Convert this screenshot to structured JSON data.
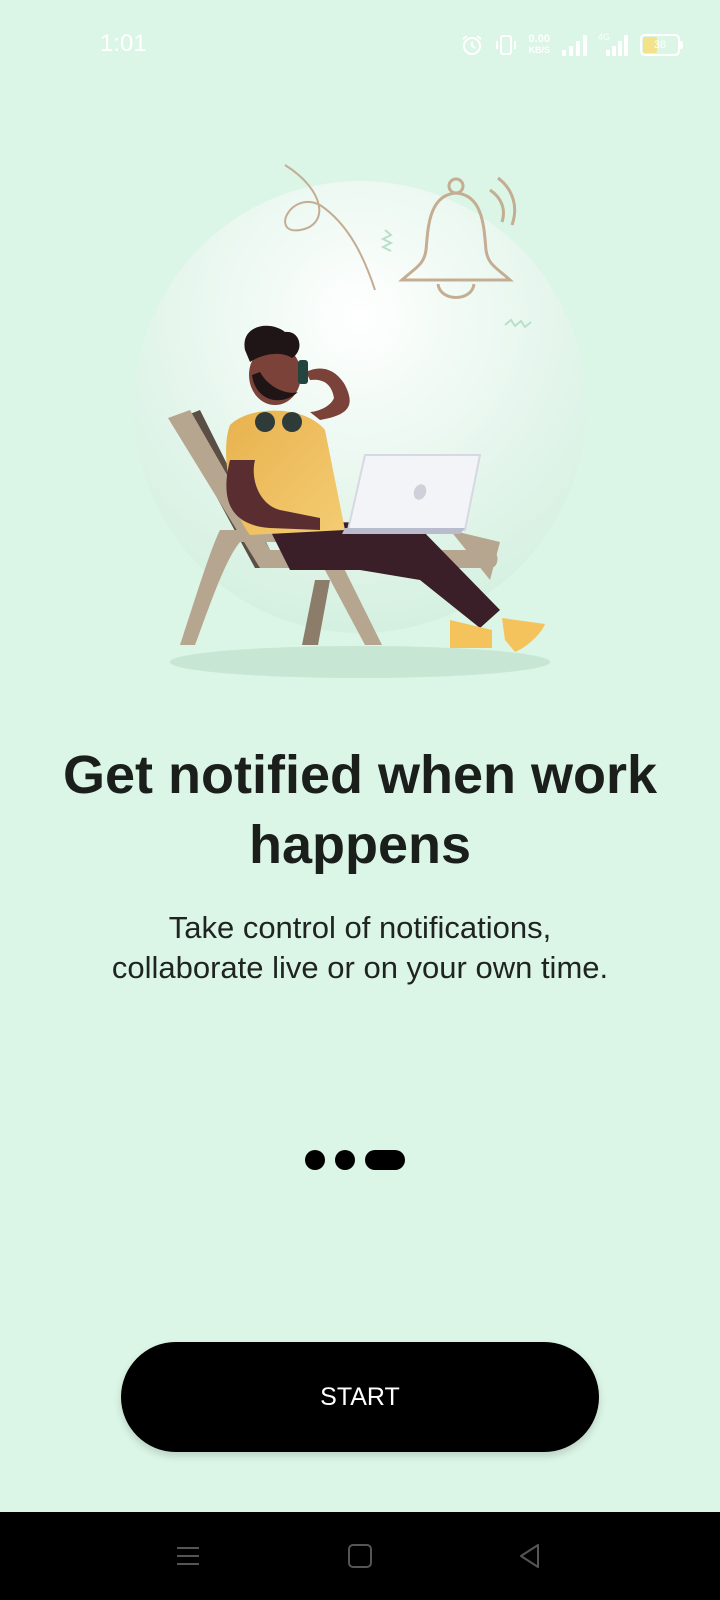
{
  "status_bar": {
    "time": "1:01",
    "net_speed_value": "0.00",
    "net_speed_unit": "KB/S",
    "network_type": "4G",
    "battery_level": "38",
    "icons": [
      "alarm-icon",
      "vibrate-icon",
      "signal-icon",
      "signal-4g-icon",
      "battery-icon"
    ]
  },
  "onboarding": {
    "illustration": "man-on-lounge-chair-with-laptop-and-bell",
    "title": "Get notified when work happens",
    "subtitle_line1": "Take control of notifications,",
    "subtitle_line2": "collaborate live or on your own time.",
    "page_indicator": {
      "total": 3,
      "current": 3
    }
  },
  "actions": {
    "start_label": "START"
  },
  "nav_bar": {
    "buttons": [
      "menu-icon",
      "home-icon",
      "back-icon"
    ]
  },
  "colors": {
    "background": "#dbf5e6",
    "button": "#000000",
    "button_text": "#ffffff",
    "title": "#1a1f1c"
  }
}
